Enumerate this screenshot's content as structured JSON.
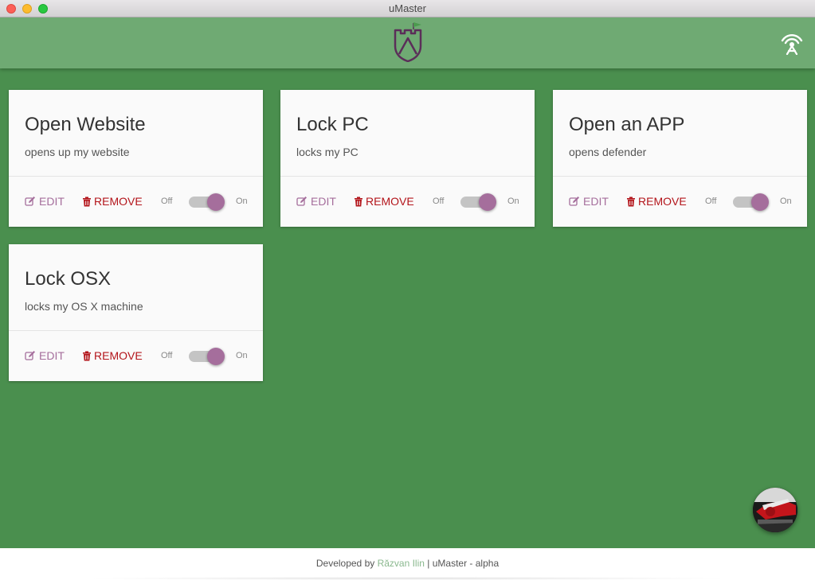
{
  "window": {
    "title": "uMaster"
  },
  "header": {
    "logo_icon": "castle-shield-logo",
    "action_icon": "broadcast-antenna-icon"
  },
  "colors": {
    "appbar": "#6faa73",
    "background": "#4a8f4e",
    "accent": "#a56e9c",
    "danger": "#b3141a"
  },
  "cards": [
    {
      "title": "Open Website",
      "description": "opens up my website",
      "edit_label": "EDIT",
      "remove_label": "REMOVE",
      "off_label": "Off",
      "on_label": "On",
      "enabled": true
    },
    {
      "title": "Lock PC",
      "description": "locks my PC",
      "edit_label": "EDIT",
      "remove_label": "REMOVE",
      "off_label": "Off",
      "on_label": "On",
      "enabled": true
    },
    {
      "title": "Open an APP",
      "description": "opens defender",
      "edit_label": "EDIT",
      "remove_label": "REMOVE",
      "off_label": "Off",
      "on_label": "On",
      "enabled": true
    },
    {
      "title": "Lock OSX",
      "description": "locks my OS X machine",
      "edit_label": "EDIT",
      "remove_label": "REMOVE",
      "off_label": "Off",
      "on_label": "On",
      "enabled": true
    }
  ],
  "footer": {
    "prefix": "Developed by ",
    "author": "Răzvan Ilin",
    "suffix": " | uMaster - alpha"
  }
}
